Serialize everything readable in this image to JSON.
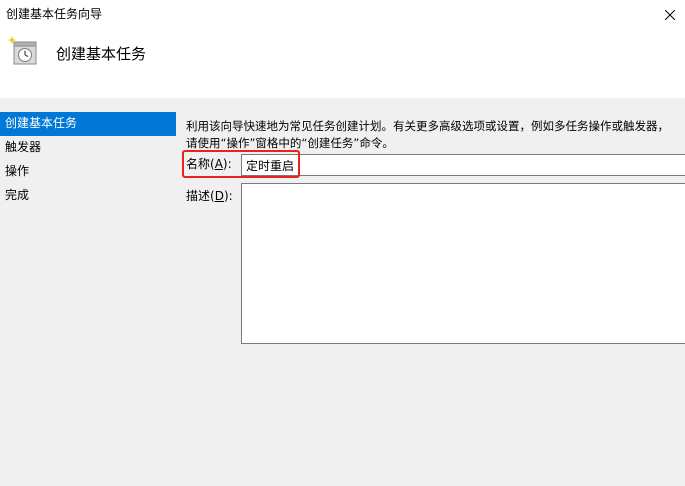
{
  "window": {
    "title": "创建基本任务向导",
    "close_glyph": "✕"
  },
  "header": {
    "title": "创建基本任务",
    "icon": "scheduled-task-clock-icon"
  },
  "sidebar": {
    "items": [
      {
        "label": "创建基本任务",
        "active": true
      },
      {
        "label": "触发器",
        "active": false
      },
      {
        "label": "操作",
        "active": false
      },
      {
        "label": "完成",
        "active": false
      }
    ]
  },
  "main": {
    "description": "利用该向导快速地为常见任务创建计划。有关更多高级选项或设置，例如多任务操作或触发器，请使用“操作”窗格中的“创建任务”命令。",
    "name_label": "名称(",
    "name_accel": "A",
    "name_label_end": "):",
    "name_value": "定时重启",
    "desc_label": "描述(",
    "desc_accel": "D",
    "desc_label_end": "):",
    "desc_value": ""
  },
  "colors": {
    "selection": "#0078d7",
    "highlight": "#e6241b",
    "panel": "#f0f0f0"
  }
}
